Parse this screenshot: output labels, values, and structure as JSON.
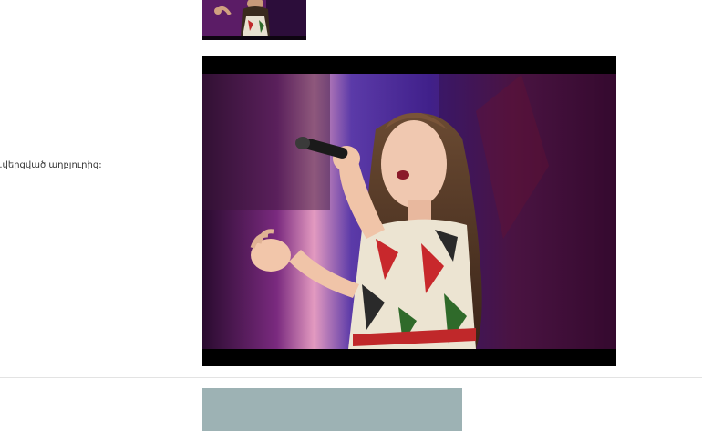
{
  "side_text": "...վերցված աղբյուրից:",
  "images": {
    "top_thumbnail": "singer-thumbnail",
    "main_photo": "singer-performing-photo",
    "bottom_placeholder": "next-media-placeholder"
  },
  "colors": {
    "stage_purple": "#5a2b9a",
    "placeholder_teal": "#9db2b4",
    "divider": "#e3e3e3"
  }
}
